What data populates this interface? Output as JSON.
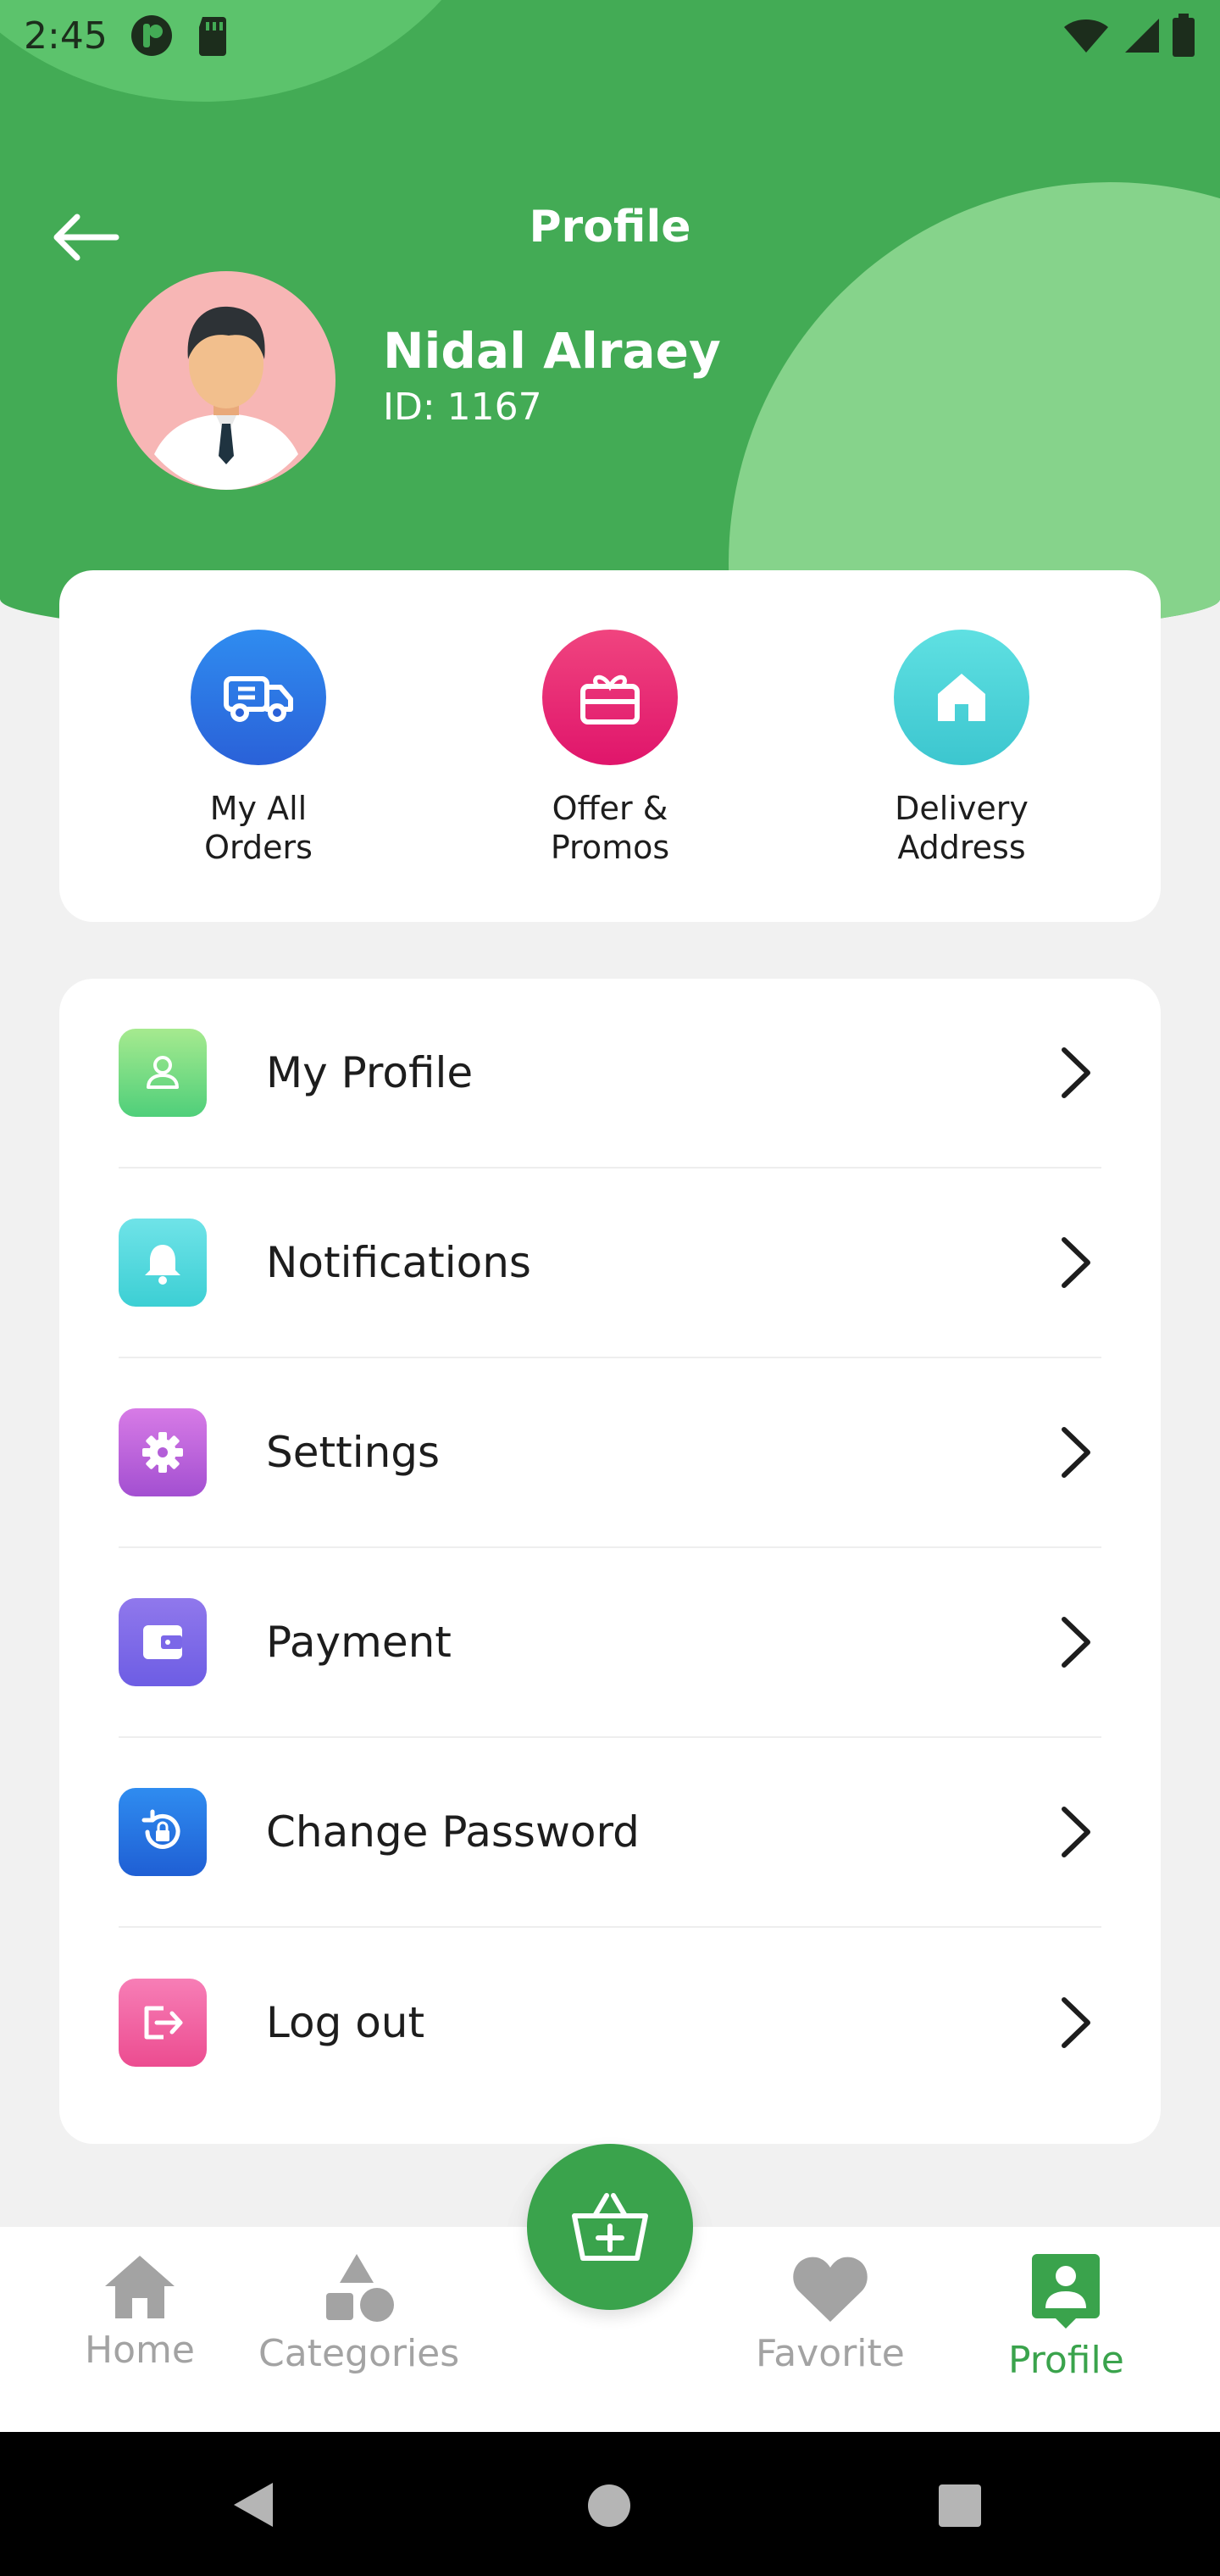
{
  "status_bar": {
    "time": "2:45"
  },
  "header": {
    "title": "Profile"
  },
  "user": {
    "name": "Nidal Alraey",
    "id_text": "ID: 1167"
  },
  "quick_actions": [
    {
      "label": "My All\nOrders",
      "icon": "truck-icon",
      "color_from": "#2f8cf0",
      "color_to": "#2a61d8"
    },
    {
      "label": "Offer &\nPromos",
      "icon": "gift-card-icon",
      "color_from": "#f0447f",
      "color_to": "#e0156b"
    },
    {
      "label": "Delivery\nAddress",
      "icon": "home-icon",
      "color_from": "#5fe0e2",
      "color_to": "#3cc6cf"
    }
  ],
  "menu": [
    {
      "label": "My Profile",
      "icon": "user-icon",
      "color_from": "#a6ea8f",
      "color_to": "#4fcf7a"
    },
    {
      "label": "Notifications",
      "icon": "bell-icon",
      "color_from": "#6fe3e8",
      "color_to": "#3ccfd4"
    },
    {
      "label": "Settings",
      "icon": "gear-icon",
      "color_from": "#d77be6",
      "color_to": "#a34fd1"
    },
    {
      "label": "Payment",
      "icon": "wallet-icon",
      "color_from": "#9078ec",
      "color_to": "#6d5de4"
    },
    {
      "label": "Change Password",
      "icon": "lock-reset-icon",
      "color_from": "#2f8cf0",
      "color_to": "#1f5fd4"
    },
    {
      "label": "Log out",
      "icon": "logout-icon",
      "color_from": "#f77eb6",
      "color_to": "#ec4c90"
    }
  ],
  "bottom_nav": {
    "items": [
      {
        "label": "Home",
        "icon": "home-icon",
        "active": false
      },
      {
        "label": "Categories",
        "icon": "shapes-icon",
        "active": false
      },
      {
        "label": "Favorite",
        "icon": "heart-icon",
        "active": false
      },
      {
        "label": "Profile",
        "icon": "profile-icon",
        "active": true
      }
    ],
    "center_button_icon": "basket-plus-icon"
  },
  "colors": {
    "primary": "#43ab55",
    "active_nav": "#3aa34c",
    "inactive_nav": "#a3a3a3"
  }
}
